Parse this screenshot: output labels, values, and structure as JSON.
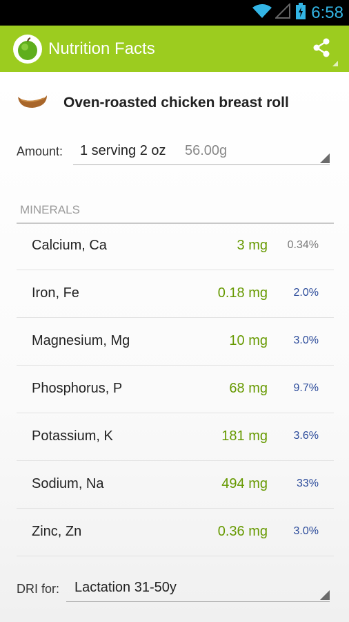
{
  "status_bar": {
    "time": "6:58",
    "time_color": "#33b5e5"
  },
  "action_bar": {
    "title": "Nutrition Facts",
    "background_color": "#9ccc1f",
    "app_icon": "green-apple-icon",
    "share_icon": "share-icon"
  },
  "food": {
    "icon": "chicken-roll-icon",
    "name": "Oven-roasted chicken breast roll"
  },
  "amount": {
    "label": "Amount:",
    "serving": "1 serving 2 oz",
    "weight": "56.00g"
  },
  "section": {
    "title": "MINERALS"
  },
  "minerals": [
    {
      "name": "Calcium, Ca",
      "amount": "3 mg",
      "percent": "0.34%",
      "percent_color": "#7a7a7a"
    },
    {
      "name": "Iron, Fe",
      "amount": "0.18 mg",
      "percent": "2.0%",
      "percent_color": "#2a4a9a"
    },
    {
      "name": "Magnesium, Mg",
      "amount": "10 mg",
      "percent": "3.0%",
      "percent_color": "#2a4a9a"
    },
    {
      "name": "Phosphorus, P",
      "amount": "68 mg",
      "percent": "9.7%",
      "percent_color": "#2a4a9a"
    },
    {
      "name": "Potassium, K",
      "amount": "181 mg",
      "percent": "3.6%",
      "percent_color": "#2a4a9a"
    },
    {
      "name": "Sodium, Na",
      "amount": "494 mg",
      "percent": "33%",
      "percent_color": "#2a4a9a"
    },
    {
      "name": "Zinc, Zn",
      "amount": "0.36 mg",
      "percent": "3.0%",
      "percent_color": "#2a4a9a"
    }
  ],
  "amount_color": "#669900",
  "dri": {
    "label": "DRI for:",
    "value": "Lactation 31-50y"
  }
}
